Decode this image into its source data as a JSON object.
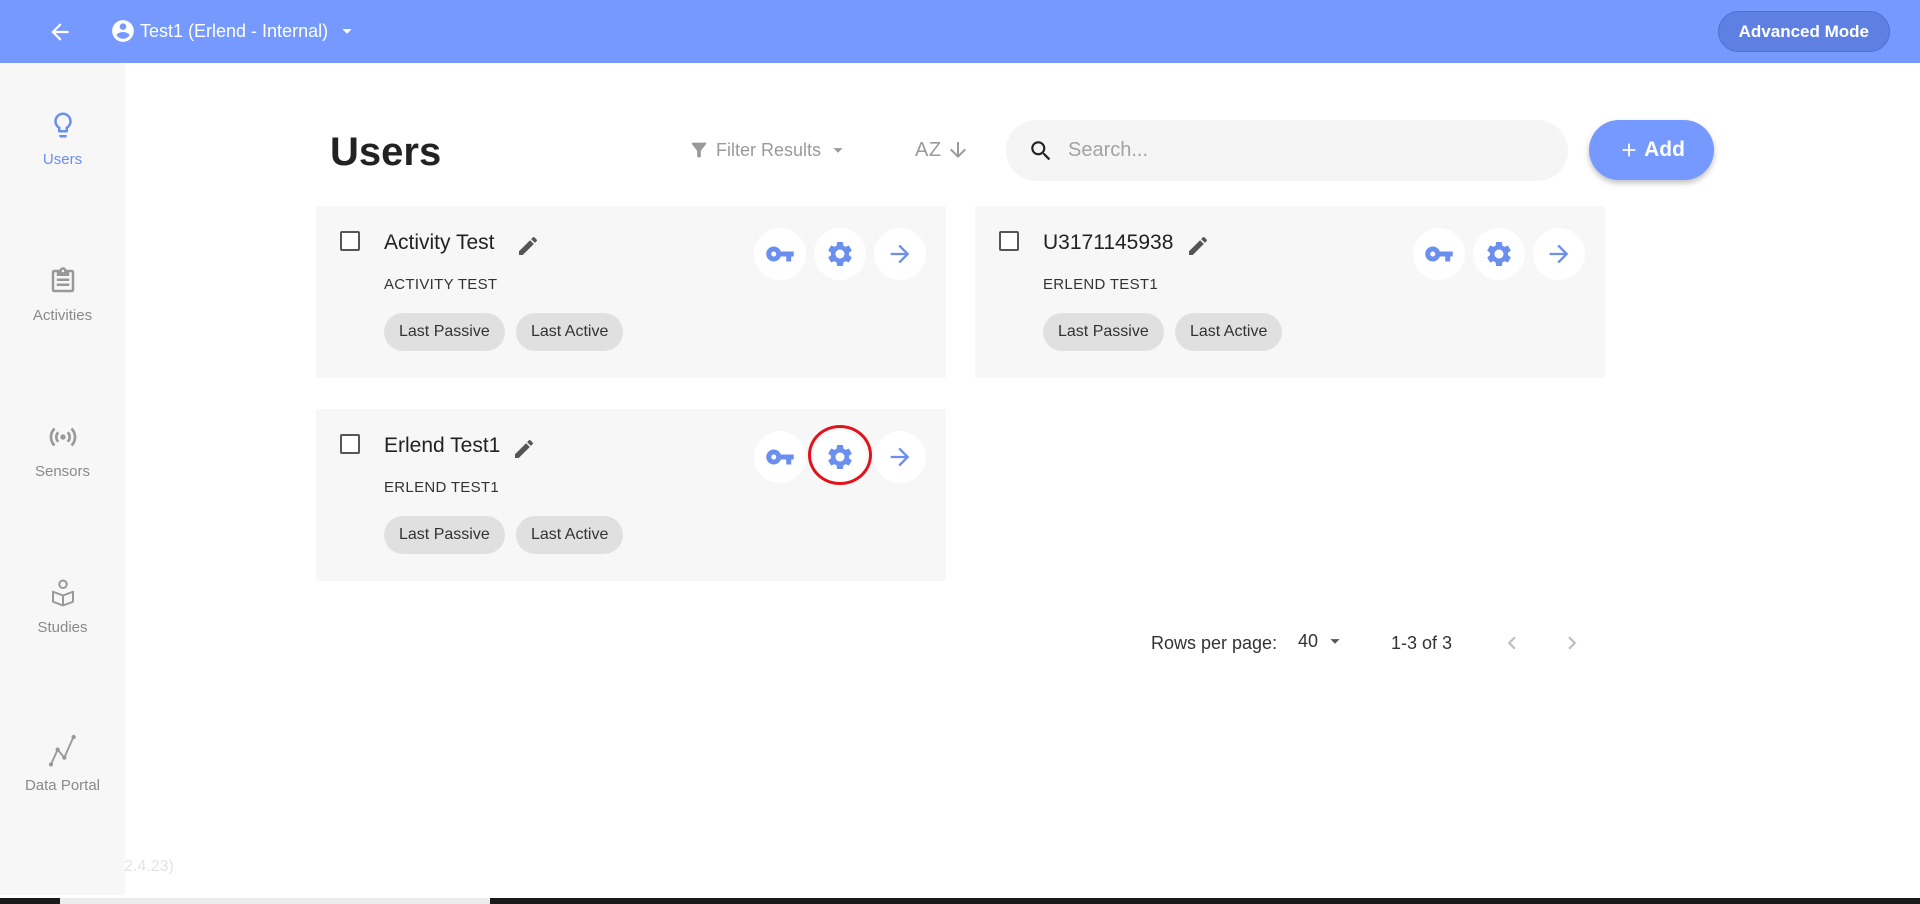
{
  "header": {
    "account_name": "Test1 (Erlend - Internal)",
    "advanced_mode_label": "Advanced Mode",
    "bar_color": "#7599ff"
  },
  "sidebar": {
    "items": [
      {
        "label": "Users",
        "icon": "lightbulb-icon",
        "active": true
      },
      {
        "label": "Activities",
        "icon": "clipboard-icon",
        "active": false
      },
      {
        "label": "Sensors",
        "icon": "broadcast-icon",
        "active": false
      },
      {
        "label": "Studies",
        "icon": "study-icon",
        "active": false
      },
      {
        "label": "Data Portal",
        "icon": "chart-line-icon",
        "active": false
      }
    ],
    "version": "2.4.23)"
  },
  "main": {
    "title": "Users",
    "filter_label": "Filter Results",
    "sort_label": "AZ",
    "search": {
      "placeholder": "Search...",
      "value": ""
    },
    "add_label": "Add"
  },
  "cards": [
    {
      "name": "Activity Test",
      "subtitle": "ACTIVITY TEST",
      "chips": [
        "Last Passive",
        "Last Active"
      ]
    },
    {
      "name": "U3171145938",
      "subtitle": "ERLEND TEST1",
      "chips": [
        "Last Passive",
        "Last Active"
      ]
    },
    {
      "name": "Erlend Test1",
      "subtitle": "ERLEND TEST1",
      "chips": [
        "Last Passive",
        "Last Active"
      ]
    }
  ],
  "pagination": {
    "rows_per_page_label": "Rows per page:",
    "rows_per_page_value": "40",
    "range_label": "1-3 of 3"
  },
  "colors": {
    "accent": "#7599ff",
    "icon_blue": "#6b8fee",
    "highlight": "#e0141c"
  }
}
